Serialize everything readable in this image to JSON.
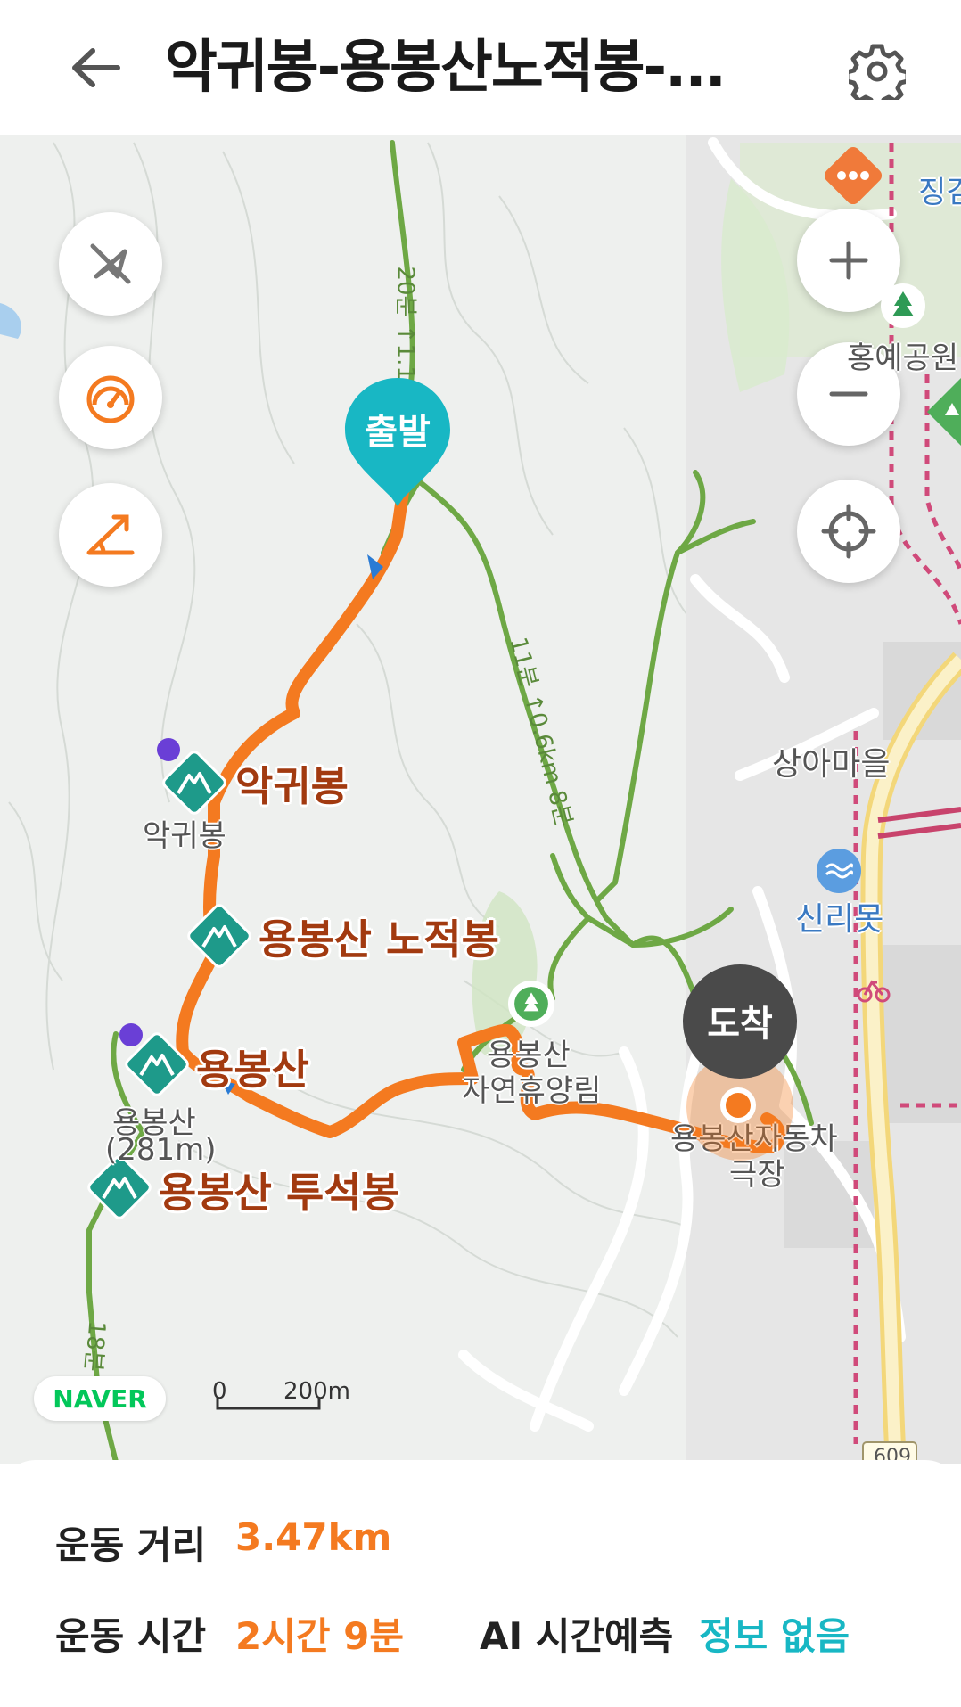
{
  "header": {
    "title": "악귀봉-용봉산노적봉-..."
  },
  "map": {
    "start_label": "출발",
    "arrive_label": "도착",
    "peaks": [
      {
        "name": "악귀봉"
      },
      {
        "name": "용봉산 노적봉"
      },
      {
        "name": "용봉산"
      },
      {
        "name": "용봉산 투석봉"
      }
    ],
    "map_labels": {
      "akgwibong_small": "악귀봉",
      "yongbongsan_small": "용봉산",
      "yongbongsan_height": "(281m)",
      "forest_name_1": "용봉산",
      "forest_name_2": "자연휴양림",
      "sangamaeul": "상아마을",
      "sinrimot": "신리못",
      "drivein_1": "용봉산자동차",
      "drivein_2": "극장",
      "park": "홍예공원",
      "top_right": "징검",
      "road_number": "609"
    },
    "trail_labels": {
      "north": "20분 ↑1.1km 14분",
      "middle": "11분 ↑0.6km 8분",
      "south": "18분"
    },
    "scale": {
      "zero": "0",
      "distance": "200m"
    },
    "brand": "NAVER",
    "colors": {
      "route": "#f47a20",
      "trail": "#6ea845",
      "start_pin": "#18b7c4",
      "arrive_pin": "#4a4a4a",
      "peak_marker": "#1e9a8a"
    },
    "icons": [
      "compass-off-icon",
      "speedometer-icon",
      "slope-icon",
      "zoom-in-icon",
      "zoom-out-icon",
      "locate-icon",
      "more-icon",
      "back-arrow-icon",
      "gear-icon"
    ]
  },
  "stats": {
    "distance_label": "운동 거리",
    "distance_value": "3.47km",
    "time_label": "운동 시간",
    "time_value": "2시간 9분",
    "ai_label": "AI 시간예측",
    "ai_value": "정보 없음"
  }
}
